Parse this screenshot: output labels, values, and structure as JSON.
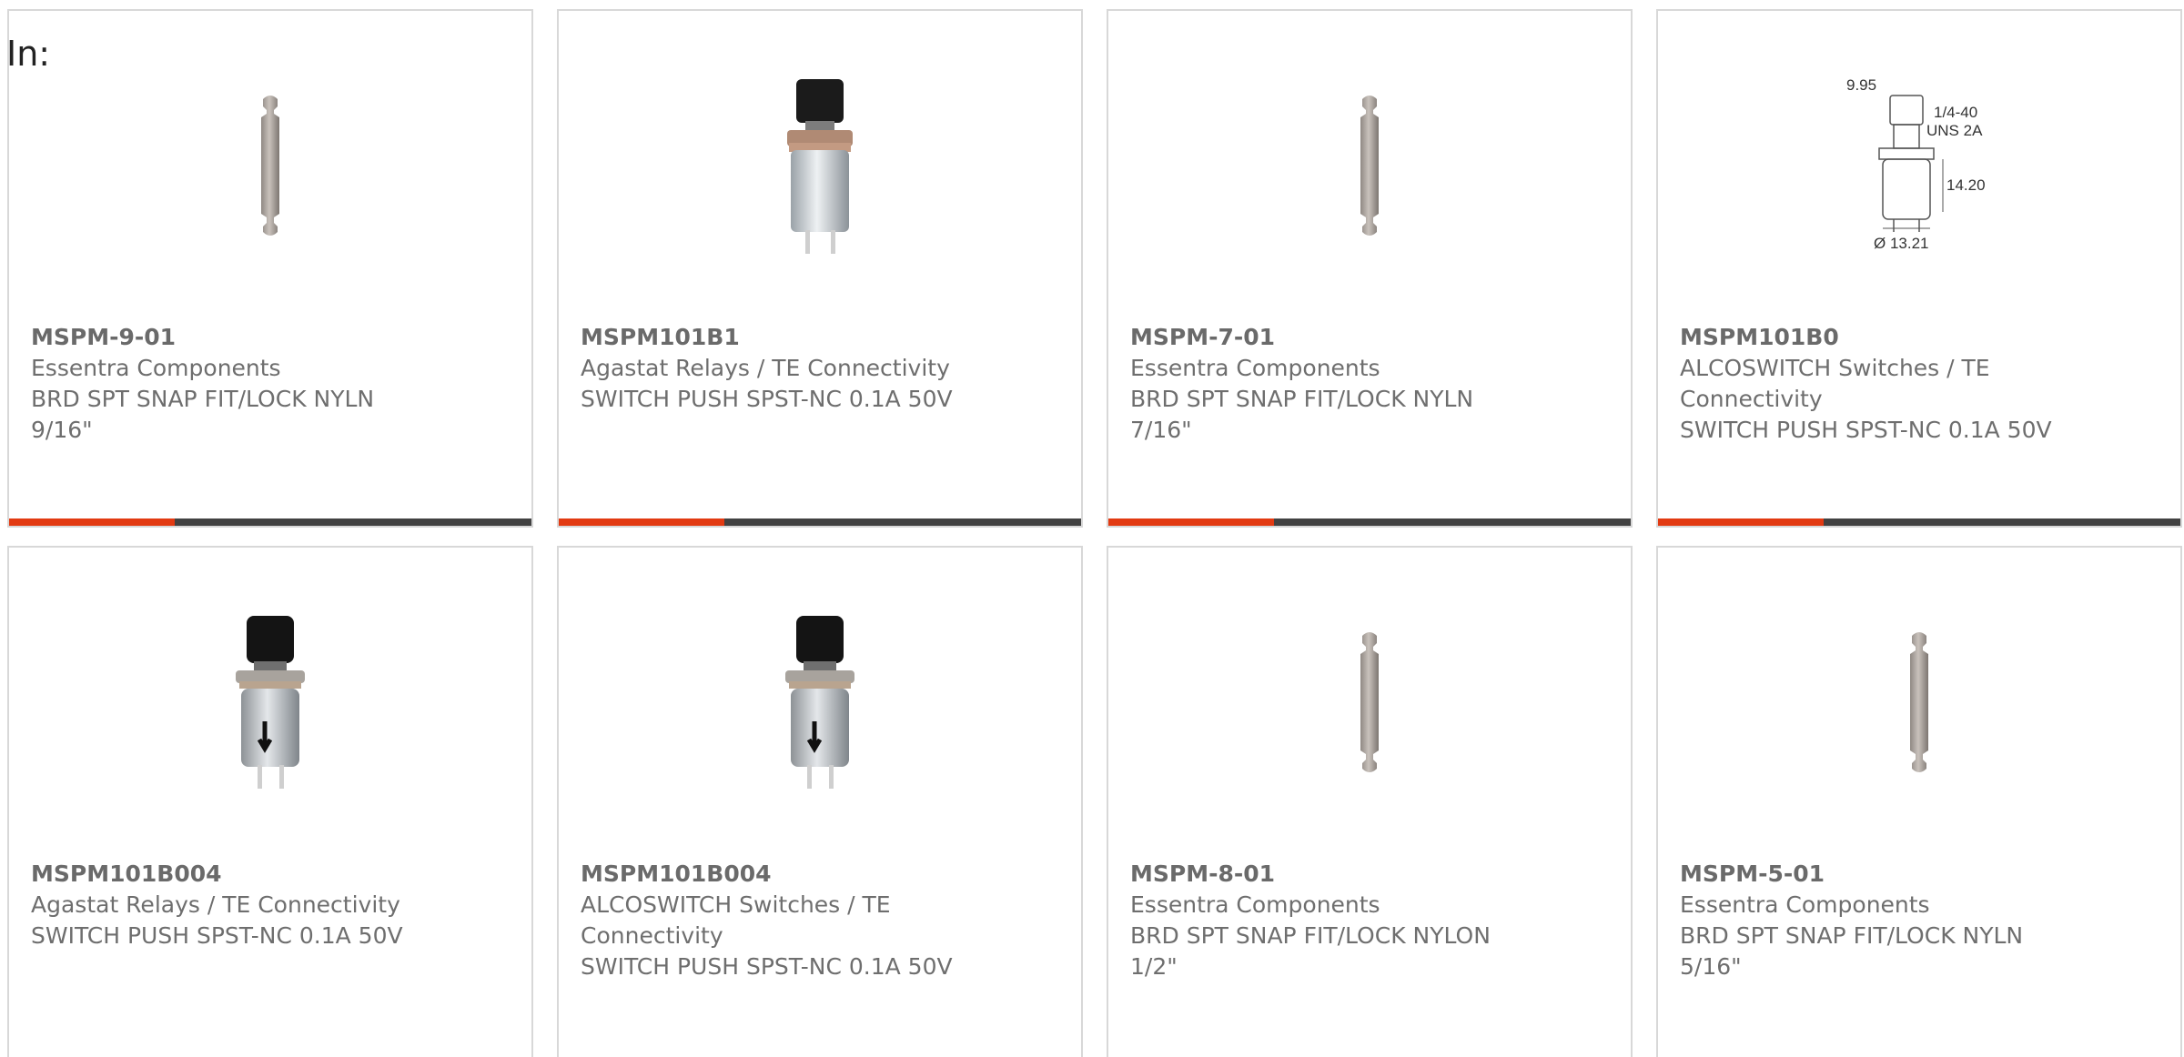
{
  "filter": {
    "label": "In:"
  },
  "products": [
    {
      "part": "MSPM-9-01",
      "maker": "Essentra Components",
      "desc": "BRD SPT SNAP FIT/LOCK NYLN 9/16\"",
      "image": "standoff-spacer"
    },
    {
      "part": "MSPM101B1",
      "maker": "Agastat Relays / TE Connectivity",
      "desc": "SWITCH PUSH SPST-NC 0.1A 50V",
      "image": "pushbutton-switch-labeled"
    },
    {
      "part": "MSPM-7-01",
      "maker": "Essentra Components",
      "desc": "BRD SPT SNAP FIT/LOCK NYLN 7/16\"",
      "image": "standoff-spacer"
    },
    {
      "part": "MSPM101B0",
      "maker": "ALCOSWITCH Switches / TE Connectivity",
      "desc": "SWITCH PUSH SPST-NC 0.1A 50V",
      "image": "switch-dimension-drawing",
      "drawing": {
        "d1": "9.95",
        "d2": "1/4-40",
        "d3": "UNS 2A",
        "d4": "14.20",
        "d5": "Ø 13.21"
      }
    },
    {
      "part": "MSPM101B004",
      "maker": "Agastat Relays / TE Connectivity",
      "desc": "SWITCH PUSH SPST-NC 0.1A 50V",
      "image": "pushbutton-switch"
    },
    {
      "part": "MSPM101B004",
      "maker": "ALCOSWITCH Switches / TE Connectivity",
      "desc": "SWITCH PUSH SPST-NC 0.1A 50V",
      "image": "pushbutton-switch"
    },
    {
      "part": "MSPM-8-01",
      "maker": "Essentra Components",
      "desc": "BRD SPT SNAP FIT/LOCK NYLON 1/2\"",
      "image": "standoff-spacer"
    },
    {
      "part": "MSPM-5-01",
      "maker": "Essentra Components",
      "desc": "BRD SPT SNAP FIT/LOCK NYLN 5/16\"",
      "image": "standoff-spacer"
    }
  ],
  "colors": {
    "accent": "#e23a12",
    "bar": "#424242",
    "border": "#d8d8d8",
    "text": "#6e6e6e"
  }
}
